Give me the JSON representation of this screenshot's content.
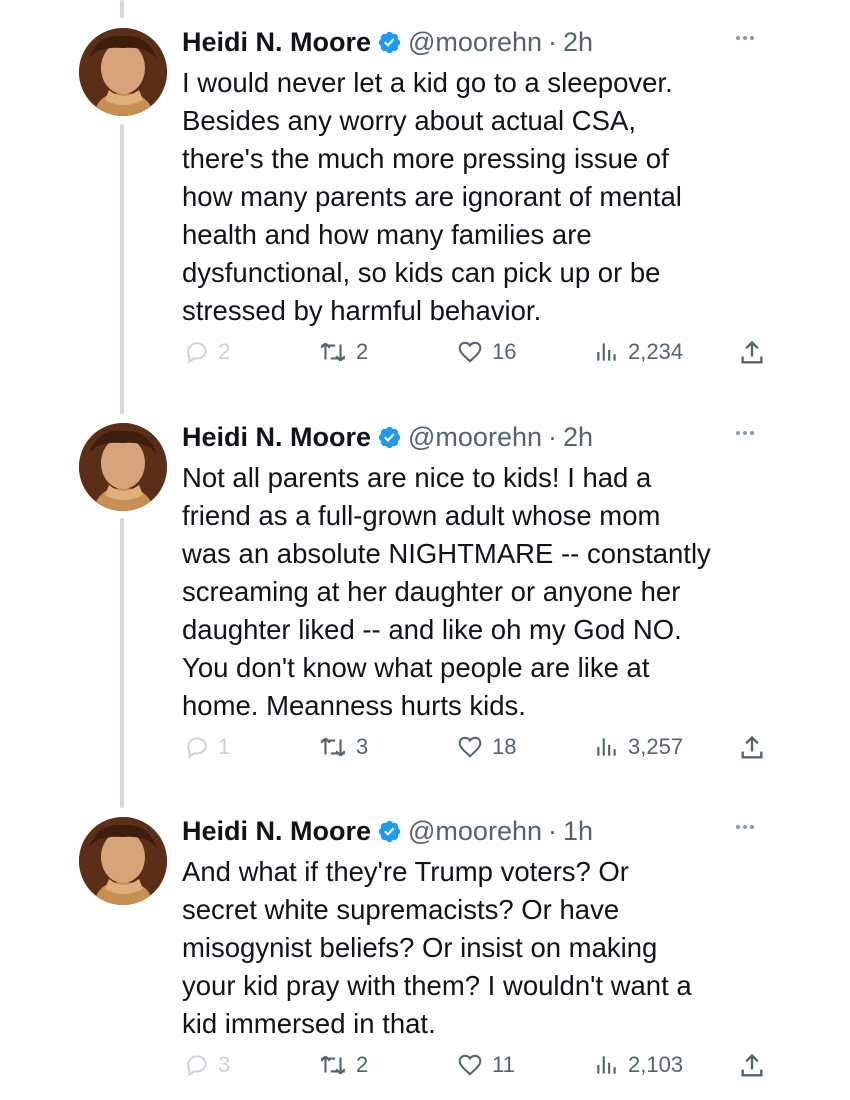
{
  "tweets": [
    {
      "name": "Heidi N. Moore",
      "handle": "@moorehn",
      "time": "2h",
      "text": "I would never let a kid go to a sleepover.\nBesides any worry about actual CSA,\nthere's the much more pressing issue of\nhow many parents are ignorant of mental\nhealth and how many families are\ndysfunctional, so kids can pick up or be\nstressed by harmful behavior.",
      "replies": "2",
      "retweets": "2",
      "likes": "16",
      "views": "2,234"
    },
    {
      "name": "Heidi N. Moore",
      "handle": "@moorehn",
      "time": "2h",
      "text": "Not all parents are nice to kids! I had a\nfriend as a full-grown adult whose mom\nwas an absolute NIGHTMARE -- constantly\nscreaming at her daughter or anyone her\ndaughter liked -- and like oh my God NO.\nYou don't know what people are like at\nhome. Meanness hurts kids.",
      "replies": "1",
      "retweets": "3",
      "likes": "18",
      "views": "3,257"
    },
    {
      "name": "Heidi N. Moore",
      "handle": "@moorehn",
      "time": "1h",
      "text": "And what if they're Trump voters? Or\nsecret white supremacists? Or have\nmisogynist beliefs? Or insist on making\nyour kid pray with them? I wouldn't want a\nkid immersed in that.",
      "replies": "3",
      "retweets": "2",
      "likes": "11",
      "views": "2,103"
    }
  ],
  "separator": "·",
  "colors": {
    "text": "#0f1419",
    "secondary": "#536471",
    "verified": "#1d9bf0",
    "thread_line": "#cfd9de"
  },
  "icons": [
    "verified-badge-icon",
    "more-icon",
    "reply-icon",
    "retweet-icon",
    "like-icon",
    "views-icon",
    "share-icon"
  ]
}
